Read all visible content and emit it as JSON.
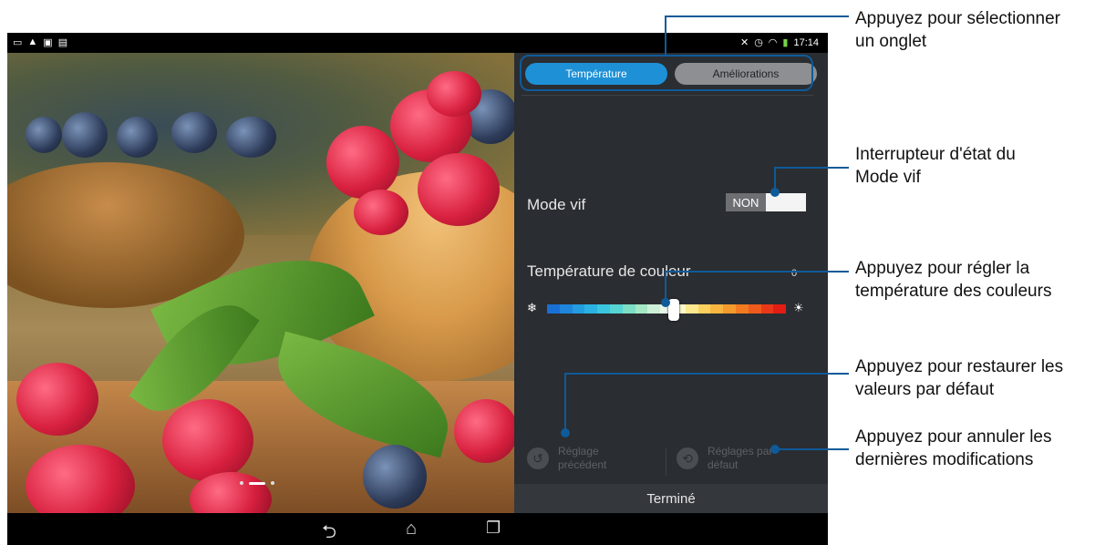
{
  "status_bar": {
    "time": "17:14"
  },
  "panel": {
    "tabs": [
      {
        "label": "Température",
        "active": true
      },
      {
        "label": "Améliorations",
        "active": false
      }
    ],
    "vivid_mode": {
      "label": "Mode vif",
      "state": "NON"
    },
    "color_temperature": {
      "label": "Température de couleur",
      "value": "0"
    },
    "actions": {
      "previous": {
        "line1": "Réglage",
        "line2": "précédent"
      },
      "defaults": {
        "line1": "Réglages par",
        "line2": "défaut"
      }
    },
    "done_label": "Terminé"
  },
  "callouts": [
    {
      "line1": "Appuyez pour sélectionner",
      "line2": "un onglet"
    },
    {
      "line1": "Interrupteur d'état du",
      "line2": "Mode vif"
    },
    {
      "line1": "Appuyez pour régler la",
      "line2": "température des couleurs"
    },
    {
      "line1": "Appuyez pour restaurer les",
      "line2": "valeurs par défaut"
    },
    {
      "line1": "Appuyez pour annuler les",
      "line2": "dernières modifications"
    }
  ],
  "colors": {
    "accent": "#1e90d6",
    "callout_line": "#0f5a99",
    "panel_bg": "#2a2d31"
  }
}
